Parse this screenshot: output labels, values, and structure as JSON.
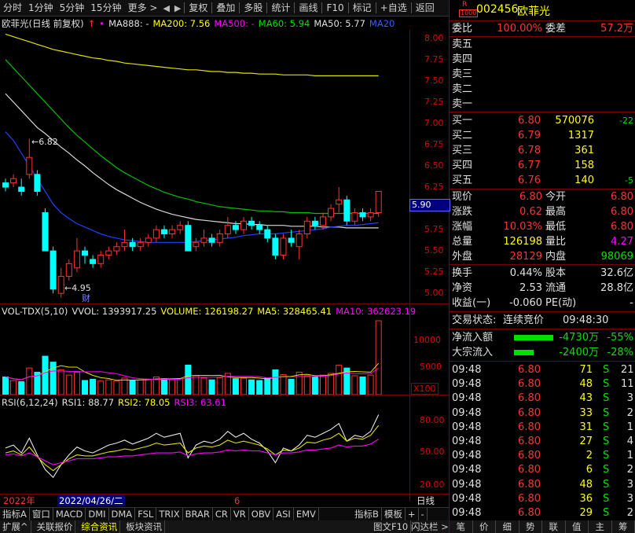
{
  "toolbar": {
    "left_items": [
      "分时",
      "1分钟",
      "5分钟",
      "15分钟",
      "更多 >"
    ],
    "right_items": [
      "复权",
      "叠加",
      "多股",
      "统计",
      "画线",
      "F10",
      "标记",
      "+自选",
      "返回"
    ]
  },
  "main_legend": {
    "title": "欧菲光(日线 前复权)",
    "ma888": "MA888: -",
    "ma200": "MA200: 7.56",
    "ma500": "MA500: -",
    "ma60": "MA60: 5.94",
    "ma50": "MA50: 5.77",
    "ma20": "MA20"
  },
  "price_axis": [
    "8.00",
    "7.75",
    "7.50",
    "7.25",
    "7.00",
    "6.75",
    "6.50",
    "6.25",
    "6.00",
    "5.75",
    "5.50",
    "5.25",
    "5.00"
  ],
  "current_price_tag": "5.90",
  "annotations": {
    "high": "6.82",
    "low": "4.95",
    "cai": "财"
  },
  "vol_legend": {
    "title": "VOL-TDX(5,10)",
    "vvol": "VVOL: 1393917.25",
    "volume": "VOLUME: 126198.27",
    "ma5": "MA5: 328465.41",
    "ma10": "MA10: 362623.19"
  },
  "vol_axis": [
    "10000",
    "5000"
  ],
  "vol_unit": "X100",
  "rsi_legend": {
    "title": "RSI(6,12,24)",
    "rsi1": "RSI1: 88.77",
    "rsi2": "RSI2: 78.05",
    "rsi3": "RSI3: 63.61"
  },
  "rsi_axis": [
    "80.00",
    "50.00",
    "20.00"
  ],
  "date_bar": {
    "year": "2022年",
    "date": "2022/04/26/二",
    "month": "6",
    "period": "日线"
  },
  "indicator_tabs": [
    "指标A",
    "窗口",
    "MACD",
    "DMI",
    "DMA",
    "FSL",
    "TRIX",
    "BRAR",
    "CR",
    "VR",
    "OBV",
    "ASI",
    "EMV"
  ],
  "indicator_right": [
    "指标B",
    "模板",
    "+",
    "-"
  ],
  "bottom_tabs": [
    "扩展^",
    "关联报价",
    "综合资讯",
    "板块资讯"
  ],
  "bottom_right": [
    "图文F10",
    "闪达栏 >"
  ],
  "right_bottom_tabs": [
    "笔",
    "价",
    "细",
    "势",
    "联",
    "值",
    "主",
    "筹"
  ],
  "stock": {
    "code": "002456",
    "name": "欧菲光",
    "badge_r": "R",
    "badge_num": "1000"
  },
  "weibi": {
    "label1": "委比",
    "value1": "100.00%",
    "label2": "委差",
    "value2": "57.2万"
  },
  "sell_levels": [
    "卖五",
    "卖四",
    "卖三",
    "卖二",
    "卖一"
  ],
  "buy_levels": [
    {
      "label": "买一",
      "price": "6.80",
      "vol": "570076",
      "chg": "-22"
    },
    {
      "label": "买二",
      "price": "6.79",
      "vol": "1317",
      "chg": ""
    },
    {
      "label": "买三",
      "price": "6.78",
      "vol": "361",
      "chg": ""
    },
    {
      "label": "买四",
      "price": "6.77",
      "vol": "158",
      "chg": ""
    },
    {
      "label": "买五",
      "price": "6.76",
      "vol": "140",
      "chg": "-5"
    }
  ],
  "quote_rows": [
    {
      "l1": "现价",
      "v1": "6.80",
      "l2": "今开",
      "v2": "6.80"
    },
    {
      "l1": "涨跌",
      "v1": "0.62",
      "l2": "最高",
      "v2": "6.80"
    },
    {
      "l1": "涨幅",
      "v1": "10.03%",
      "l2": "最低",
      "v2": "6.80"
    },
    {
      "l1": "总量",
      "v1": "126198",
      "l2": "量比",
      "v2": "4.27"
    },
    {
      "l1": "外盘",
      "v1": "28129",
      "l2": "内盘",
      "v2": "98069"
    }
  ],
  "fund_rows": [
    {
      "l1": "换手",
      "v1": "0.44%",
      "l2": "股本",
      "v2": "32.6亿"
    },
    {
      "l1": "净资",
      "v1": "2.53",
      "l2": "流通",
      "v2": "28.8亿"
    },
    {
      "l1": "收益(一)",
      "v1": "-0.060",
      "l2": "PE(动)",
      "v2": "-"
    }
  ],
  "trade_status": {
    "label": "交易状态:",
    "value": "连续竞价",
    "time": "09:48:30"
  },
  "flows": [
    {
      "label": "净流入额",
      "value": "-4730万",
      "pct": "-55%",
      "bar": 0.55
    },
    {
      "label": "大宗流入",
      "value": "-2400万",
      "pct": "-28%",
      "bar": 0.28
    }
  ],
  "ticks": [
    {
      "time": "09:48",
      "price": "6.80",
      "vol": "71",
      "side": "S",
      "n": "21"
    },
    {
      "time": "09:48",
      "price": "6.80",
      "vol": "48",
      "side": "S",
      "n": "11"
    },
    {
      "time": "09:48",
      "price": "6.80",
      "vol": "43",
      "side": "S",
      "n": "3"
    },
    {
      "time": "09:48",
      "price": "6.80",
      "vol": "33",
      "side": "S",
      "n": "2"
    },
    {
      "time": "09:48",
      "price": "6.80",
      "vol": "31",
      "side": "S",
      "n": "1"
    },
    {
      "time": "09:48",
      "price": "6.80",
      "vol": "27",
      "side": "S",
      "n": "4"
    },
    {
      "time": "09:48",
      "price": "6.80",
      "vol": "2",
      "side": "S",
      "n": "1"
    },
    {
      "time": "09:48",
      "price": "6.80",
      "vol": "6",
      "side": "S",
      "n": "2"
    },
    {
      "time": "09:48",
      "price": "6.80",
      "vol": "48",
      "side": "S",
      "n": "3"
    },
    {
      "time": "09:48",
      "price": "6.80",
      "vol": "36",
      "side": "S",
      "n": "3"
    },
    {
      "time": "09:48",
      "price": "6.80",
      "vol": "29",
      "side": "S",
      "n": "2"
    }
  ],
  "chart_data": [
    {
      "type": "candlestick",
      "ylim": [
        4.9,
        8.1
      ],
      "candles": [
        [
          6.3,
          6.25,
          6.35,
          6.2
        ],
        [
          6.3,
          6.35,
          6.4,
          6.25
        ],
        [
          6.25,
          6.2,
          6.35,
          6.15
        ],
        [
          6.4,
          6.6,
          6.82,
          6.35
        ],
        [
          6.4,
          6.2,
          6.45,
          6.15
        ],
        [
          5.95,
          5.5,
          6.0,
          5.5
        ],
        [
          5.5,
          5.05,
          5.55,
          5.0
        ],
        [
          5.0,
          5.2,
          5.3,
          4.95
        ],
        [
          5.2,
          5.35,
          5.4,
          5.15
        ],
        [
          5.3,
          5.5,
          5.65,
          5.25
        ],
        [
          5.5,
          5.45,
          5.55,
          5.35
        ],
        [
          5.4,
          5.35,
          5.45,
          5.3
        ],
        [
          5.35,
          5.45,
          5.5,
          5.3
        ],
        [
          5.45,
          5.5,
          5.55,
          5.4
        ],
        [
          5.5,
          5.55,
          5.6,
          5.45
        ],
        [
          5.55,
          5.6,
          5.75,
          5.5
        ],
        [
          5.6,
          5.55,
          5.65,
          5.5
        ],
        [
          5.55,
          5.6,
          5.65,
          5.5
        ],
        [
          5.6,
          5.65,
          5.7,
          5.55
        ],
        [
          5.65,
          5.75,
          5.8,
          5.6
        ],
        [
          5.75,
          5.7,
          5.8,
          5.65
        ],
        [
          5.7,
          5.75,
          5.8,
          5.65
        ],
        [
          5.75,
          5.8,
          5.85,
          5.7
        ],
        [
          5.8,
          5.5,
          5.85,
          5.5
        ],
        [
          5.55,
          5.6,
          5.65,
          5.5
        ],
        [
          5.6,
          5.65,
          5.75,
          5.55
        ],
        [
          5.65,
          5.6,
          5.7,
          5.55
        ],
        [
          5.6,
          5.7,
          5.75,
          5.55
        ],
        [
          5.7,
          5.8,
          5.9,
          5.65
        ],
        [
          5.8,
          5.75,
          5.85,
          5.7
        ],
        [
          5.75,
          5.85,
          5.9,
          5.7
        ],
        [
          5.85,
          5.8,
          5.9,
          5.75
        ],
        [
          5.8,
          5.75,
          5.85,
          5.7
        ],
        [
          5.75,
          5.65,
          5.8,
          5.6
        ],
        [
          5.65,
          5.45,
          5.7,
          5.4
        ],
        [
          5.45,
          5.65,
          5.7,
          5.4
        ],
        [
          5.65,
          5.6,
          5.75,
          5.55
        ],
        [
          5.55,
          5.7,
          5.75,
          5.4
        ],
        [
          5.7,
          5.85,
          5.9,
          5.65
        ],
        [
          5.85,
          5.8,
          5.9,
          5.75
        ],
        [
          5.8,
          5.9,
          5.95,
          5.75
        ],
        [
          5.9,
          6.0,
          6.05,
          5.85
        ],
        [
          6.05,
          6.1,
          6.25,
          5.95
        ],
        [
          6.1,
          5.85,
          6.15,
          5.8
        ],
        [
          5.85,
          5.95,
          6.0,
          5.8
        ],
        [
          5.95,
          5.9,
          6.0,
          5.85
        ],
        [
          5.9,
          5.95,
          6.0,
          5.85
        ],
        [
          5.95,
          6.2,
          6.2,
          5.9
        ]
      ],
      "ma20": [
        6.9,
        6.8,
        6.65,
        6.5,
        6.35,
        6.2,
        6.05,
        5.95,
        5.88,
        5.82,
        5.78,
        5.74,
        5.7,
        5.67,
        5.65,
        5.63,
        5.62,
        5.61,
        5.6,
        5.6,
        5.6,
        5.6,
        5.6,
        5.6,
        5.61,
        5.62,
        5.63,
        5.64,
        5.65,
        5.66,
        5.68,
        5.69,
        5.7,
        5.7,
        5.7,
        5.71,
        5.72,
        5.73,
        5.74,
        5.75,
        5.76,
        5.78,
        5.79,
        5.8,
        5.8,
        5.81,
        5.82,
        5.83
      ],
      "ma50": [
        7.35,
        7.25,
        7.15,
        7.05,
        6.95,
        6.88,
        6.8,
        6.72,
        6.65,
        6.57,
        6.5,
        6.42,
        6.35,
        6.28,
        6.22,
        6.17,
        6.12,
        6.07,
        6.03,
        5.99,
        5.96,
        5.93,
        5.91,
        5.89,
        5.87,
        5.86,
        5.85,
        5.84,
        5.83,
        5.82,
        5.82,
        5.81,
        5.81,
        5.8,
        5.8,
        5.8,
        5.79,
        5.79,
        5.79,
        5.79,
        5.78,
        5.78,
        5.78,
        5.77,
        5.77,
        5.77,
        5.77,
        5.77
      ],
      "ma60": [
        7.75,
        7.65,
        7.55,
        7.45,
        7.35,
        7.25,
        7.15,
        7.05,
        6.95,
        6.86,
        6.78,
        6.7,
        6.62,
        6.55,
        6.48,
        6.42,
        6.37,
        6.32,
        6.27,
        6.23,
        6.19,
        6.16,
        6.13,
        6.11,
        6.08,
        6.06,
        6.04,
        6.02,
        6.01,
        6.0,
        5.99,
        5.98,
        5.97,
        5.97,
        5.96,
        5.96,
        5.95,
        5.95,
        5.95,
        5.94,
        5.94,
        5.94,
        5.94,
        5.94,
        5.94,
        5.94,
        5.94,
        5.94
      ],
      "ma200": [
        8.05,
        8.02,
        7.99,
        7.96,
        7.93,
        7.9,
        7.87,
        7.85,
        7.83,
        7.81,
        7.79,
        7.77,
        7.76,
        7.74,
        7.73,
        7.71,
        7.7,
        7.69,
        7.68,
        7.67,
        7.66,
        7.65,
        7.64,
        7.63,
        7.63,
        7.62,
        7.61,
        7.61,
        7.6,
        7.6,
        7.59,
        7.59,
        7.58,
        7.58,
        7.58,
        7.57,
        7.57,
        7.57,
        7.57,
        7.56,
        7.56,
        7.56,
        7.56,
        7.56,
        7.56,
        7.56,
        7.56,
        7.56
      ]
    },
    {
      "type": "bar",
      "title": "VOL-TDX(5,10)",
      "ylim": [
        0,
        12500
      ],
      "values": [
        3000,
        2400,
        2200,
        4500,
        3800,
        6500,
        5500,
        4200,
        3300,
        3800,
        2400,
        2600,
        2300,
        2500,
        2300,
        2800,
        2400,
        2500,
        2600,
        3000,
        2700,
        2600,
        2700,
        5000,
        3200,
        2800,
        2500,
        2900,
        3600,
        2700,
        2800,
        2500,
        2400,
        2800,
        4200,
        3400,
        2600,
        3800,
        3200,
        3000,
        3300,
        3600,
        5000,
        4500,
        3200,
        3000,
        3300,
        12500
      ]
    },
    {
      "type": "line",
      "title": "RSI(6,12,24)",
      "ylim": [
        10,
        95
      ],
      "rsi1": [
        55,
        58,
        50,
        65,
        48,
        33,
        25,
        38,
        48,
        56,
        52,
        50,
        54,
        58,
        60,
        63,
        59,
        62,
        65,
        70,
        66,
        68,
        70,
        45,
        58,
        62,
        60,
        64,
        72,
        66,
        70,
        64,
        60,
        52,
        40,
        55,
        52,
        58,
        68,
        66,
        70,
        74,
        80,
        62,
        68,
        66,
        72,
        89
      ],
      "rsi2": [
        50,
        52,
        48,
        56,
        46,
        38,
        32,
        38,
        44,
        48,
        47,
        47,
        49,
        51,
        52,
        54,
        53,
        55,
        57,
        60,
        58,
        59,
        60,
        50,
        55,
        57,
        56,
        58,
        63,
        60,
        62,
        60,
        58,
        54,
        48,
        53,
        52,
        55,
        61,
        60,
        63,
        65,
        70,
        62,
        65,
        64,
        68,
        78
      ],
      "rsi3": [
        48,
        49,
        47,
        50,
        46,
        42,
        38,
        40,
        42,
        44,
        44,
        44,
        45,
        46,
        46,
        47,
        47,
        48,
        49,
        50,
        50,
        50,
        51,
        47,
        49,
        50,
        50,
        51,
        53,
        52,
        53,
        52,
        52,
        50,
        48,
        50,
        50,
        51,
        53,
        53,
        54,
        55,
        58,
        56,
        57,
        57,
        59,
        64
      ]
    }
  ]
}
